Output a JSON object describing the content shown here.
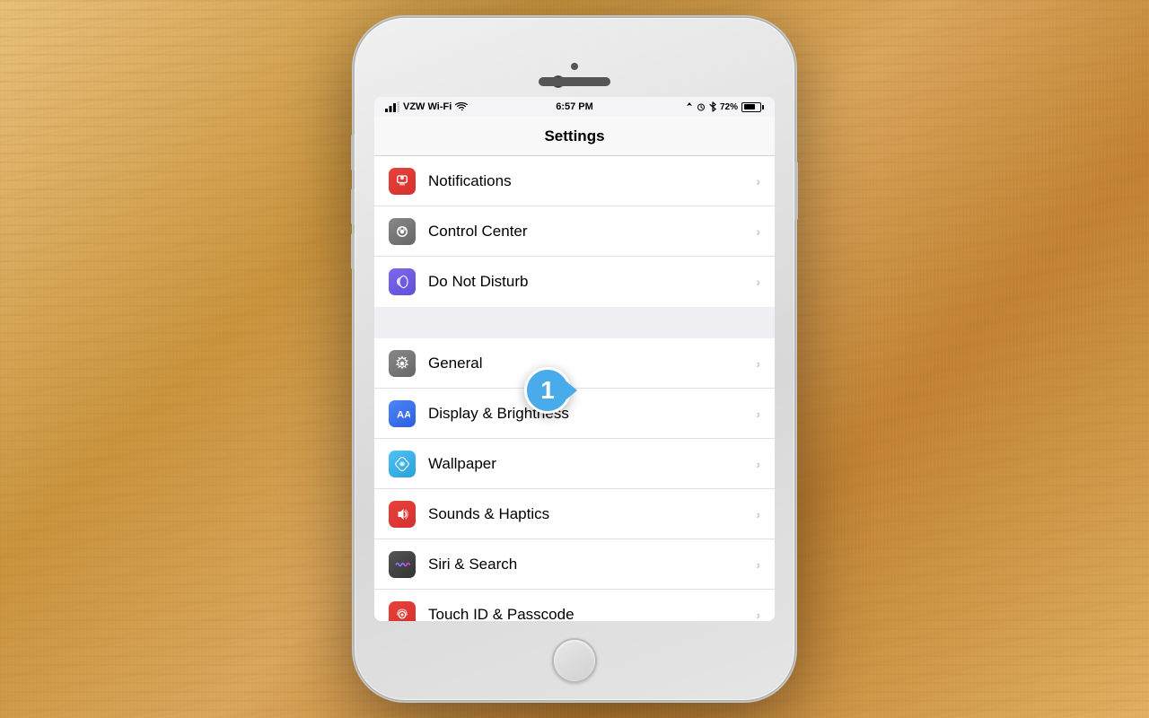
{
  "background": {
    "color": "#d4a96a"
  },
  "status_bar": {
    "carrier": "VZW Wi-Fi",
    "time": "6:57 PM",
    "location_icon": "▶",
    "battery_percent": "72%"
  },
  "nav": {
    "title": "Settings"
  },
  "badge": {
    "number": "1"
  },
  "settings_sections": [
    {
      "id": "section1",
      "rows": [
        {
          "id": "notifications",
          "label": "Notifications",
          "icon_class": "icon-notifications",
          "icon_type": "notifications"
        },
        {
          "id": "control-center",
          "label": "Control Center",
          "icon_class": "icon-control-center",
          "icon_type": "control-center"
        },
        {
          "id": "dnd",
          "label": "Do Not Disturb",
          "icon_class": "icon-dnd",
          "icon_type": "dnd"
        }
      ]
    },
    {
      "id": "section2",
      "rows": [
        {
          "id": "general",
          "label": "General",
          "icon_class": "icon-general",
          "icon_type": "general"
        },
        {
          "id": "display",
          "label": "Display & Brightness",
          "icon_class": "icon-display",
          "icon_type": "display"
        },
        {
          "id": "wallpaper",
          "label": "Wallpaper",
          "icon_class": "icon-wallpaper",
          "icon_type": "wallpaper"
        },
        {
          "id": "sounds",
          "label": "Sounds & Haptics",
          "icon_class": "icon-sounds",
          "icon_type": "sounds"
        },
        {
          "id": "siri",
          "label": "Siri & Search",
          "icon_class": "icon-siri",
          "icon_type": "siri"
        },
        {
          "id": "touchid",
          "label": "Touch ID & Passcode",
          "icon_class": "icon-touchid",
          "icon_type": "touchid"
        }
      ]
    }
  ],
  "chevron": "›"
}
